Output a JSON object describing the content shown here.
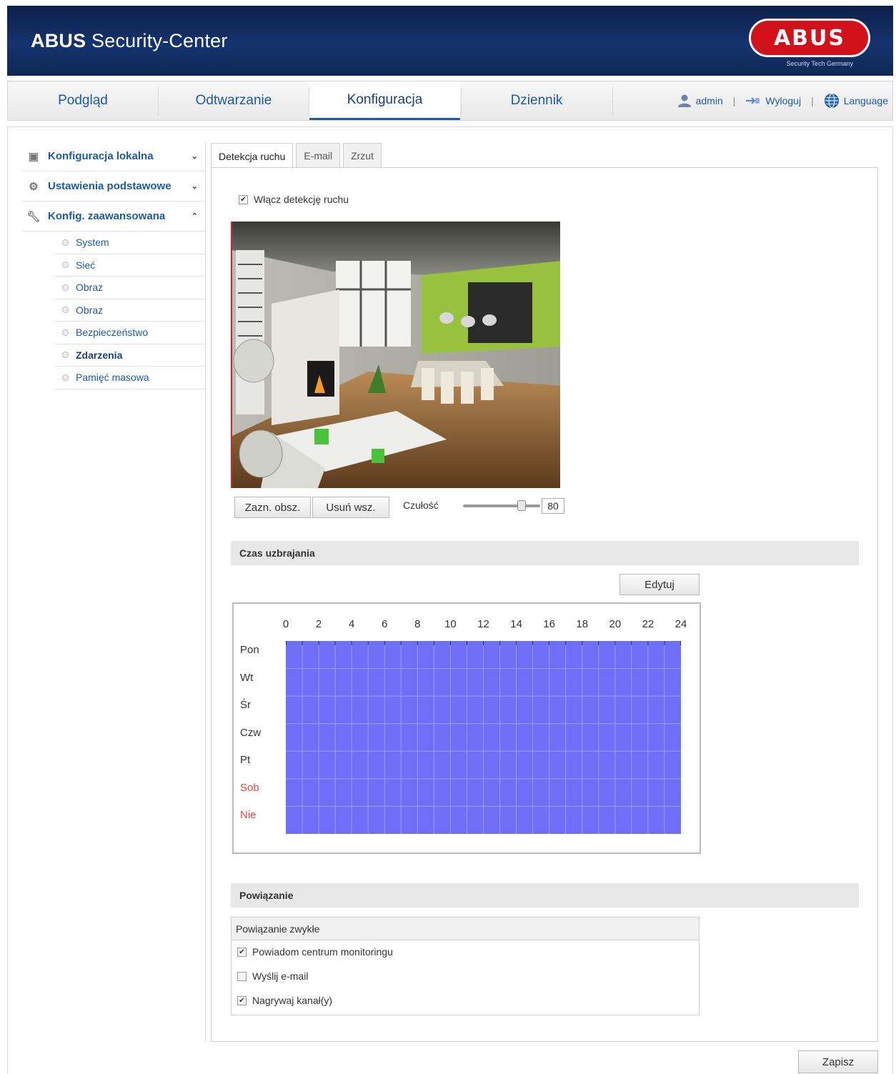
{
  "header": {
    "title_bold": "ABUS",
    "title_rest": "Security-Center",
    "logo_text": "ABUS",
    "logo_tagline": "Security Tech Germany"
  },
  "nav": {
    "tabs": [
      {
        "label": "Podgląd",
        "active": false
      },
      {
        "label": "Odtwarzanie",
        "active": false
      },
      {
        "label": "Konfiguracja",
        "active": true
      },
      {
        "label": "Dziennik",
        "active": false
      }
    ],
    "user": "admin",
    "logout": "Wyloguj",
    "language": "Language"
  },
  "sidebar": {
    "groups": [
      {
        "label": "Konfiguracja lokalna",
        "icon": "monitor-icon",
        "expanded": false
      },
      {
        "label": "Ustawienia podstawowe",
        "icon": "gear-icon",
        "expanded": false
      },
      {
        "label": "Konfig. zaawansowana",
        "icon": "wrench-icon",
        "expanded": true
      }
    ],
    "items": [
      {
        "label": "System"
      },
      {
        "label": "Sieć"
      },
      {
        "label": "Obraz"
      },
      {
        "label": "Obraz"
      },
      {
        "label": "Bezpieczeństwo"
      },
      {
        "label": "Zdarzenia",
        "active": true
      },
      {
        "label": "Pamięć masowa"
      }
    ]
  },
  "subtabs": [
    "Detekcja ruchu",
    "E-mail",
    "Zrzut"
  ],
  "motion": {
    "enable_label": "Włącz detekcję ruchu",
    "enabled": true,
    "draw_area_button": "Zazn. obsz.",
    "clear_all_button": "Usuń wsz.",
    "sensitivity_label": "Czułość",
    "sensitivity_value": "80"
  },
  "schedule": {
    "section_title": "Czas uzbrajania",
    "edit_button": "Edytuj",
    "hours": [
      "0",
      "2",
      "4",
      "6",
      "8",
      "10",
      "12",
      "14",
      "16",
      "18",
      "20",
      "22",
      "24"
    ],
    "days": [
      "Pon",
      "Wt",
      "Śr",
      "Czw",
      "Pt",
      "Sob",
      "Nie"
    ],
    "weekend_color": "#e0463c",
    "armed_color": "#6e6ef7",
    "armed_all_week": true
  },
  "linkage": {
    "section_title": "Powiązanie",
    "box_title": "Powiązanie zwykłe",
    "options": [
      {
        "label": "Powiadom centrum monitoringu",
        "checked": true
      },
      {
        "label": "Wyślij e-mail",
        "checked": false
      },
      {
        "label": "Nagrywaj kanał(y)",
        "checked": true
      }
    ]
  },
  "save_button": "Zapisz",
  "colors": {
    "header_bg": "#14336e",
    "link_blue": "#1c5aa6",
    "brand_red": "#d3111b"
  }
}
